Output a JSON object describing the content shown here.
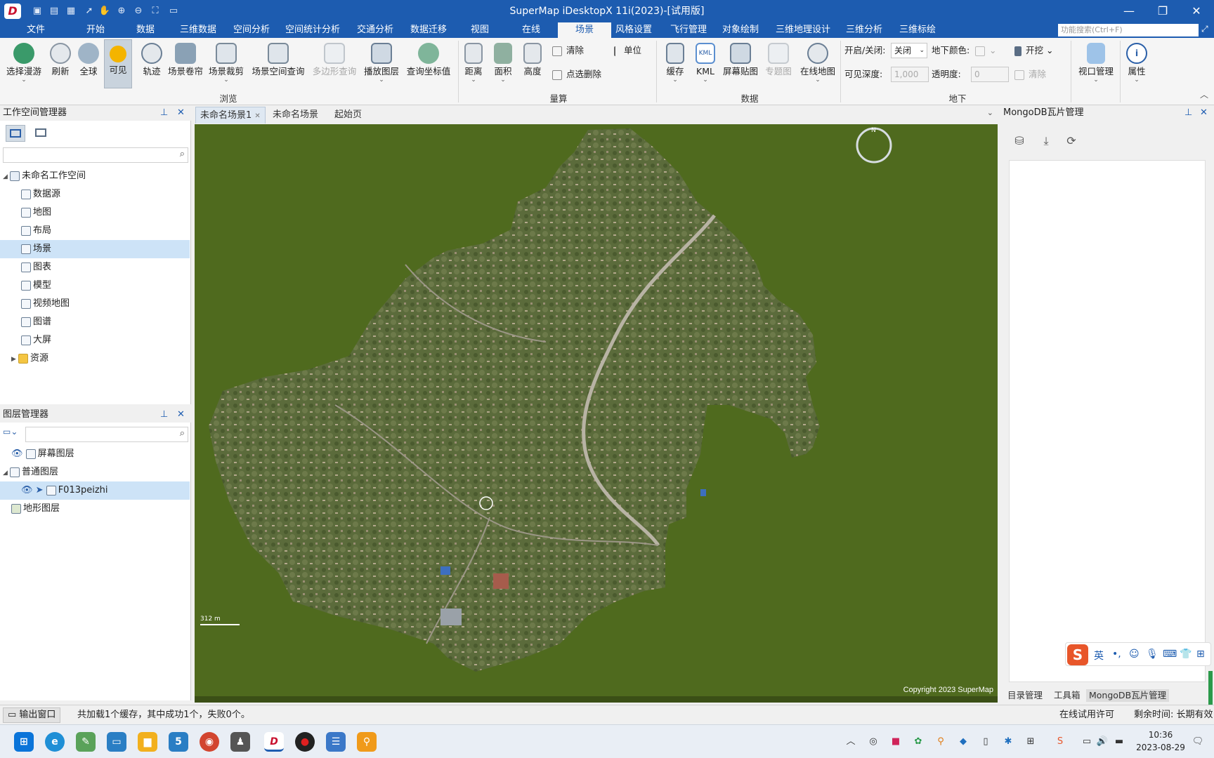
{
  "titlebar": {
    "title": "SuperMap iDesktopX 11i(2023)-[试用版]",
    "logo": "D",
    "quick_icons": [
      "save-icon",
      "save-as-icon",
      "new-icon",
      "select-icon",
      "pan-icon",
      "zoom-in-icon",
      "zoom-out-icon",
      "full-extent-icon",
      "open-folder-icon"
    ],
    "controls": [
      "minimize",
      "restore",
      "close"
    ]
  },
  "menubar": {
    "items": [
      "文件",
      "开始",
      "数据",
      "三维数据",
      "空间分析",
      "空间统计分析",
      "交通分析",
      "数据迁移",
      "视图",
      "在线",
      "场景",
      "风格设置",
      "飞行管理",
      "对象绘制",
      "三维地理设计",
      "三维分析",
      "三维标绘"
    ],
    "active": "场景",
    "search_placeholder": "功能搜索(Ctrl+F)"
  },
  "ribbon": {
    "buttons": {
      "roam": "选择漫游",
      "refresh": "刷新",
      "globe": "全球",
      "visible": "可见",
      "track": "轨迹",
      "roller": "场景卷帘",
      "clip": "场景裁剪",
      "spatial_query": "场景空间查询",
      "polygon_query": "多边形查询",
      "play_layer": "播放图层",
      "query_coord": "查询坐标值",
      "distance": "距离",
      "area": "面积",
      "height": "高度",
      "clear": "清除",
      "point_delete": "点选删除",
      "unit": "单位",
      "cache": "缓存",
      "kml": "KML",
      "screen_paste": "屏幕贴图",
      "thematic": "专题图",
      "online_map": "在线地图",
      "onoff_label": "开启/关闭:",
      "onoff_value": "关闭",
      "underground_color": "地下颜色:",
      "excavate": "开挖",
      "visible_depth": "可见深度:",
      "visible_depth_value": "1,000",
      "transparency": "透明度:",
      "transparency_value": "0",
      "clear2": "清除",
      "viewport": "视口管理",
      "property": "属性"
    },
    "groups": {
      "browse": "浏览",
      "measure": "量算",
      "data": "数据",
      "underground": "地下"
    },
    "kml_icon_text": "KML"
  },
  "workspace_panel": {
    "title": "工作空间管理器",
    "tree": [
      {
        "label": "未命名工作空间",
        "icon": "workspace-icon"
      },
      {
        "label": "数据源",
        "icon": "datasource-icon"
      },
      {
        "label": "地图",
        "icon": "map-icon"
      },
      {
        "label": "布局",
        "icon": "layout-icon"
      },
      {
        "label": "场景",
        "icon": "scene-icon"
      },
      {
        "label": "图表",
        "icon": "chart-icon"
      },
      {
        "label": "模型",
        "icon": "model-icon"
      },
      {
        "label": "视频地图",
        "icon": "video-map-icon"
      },
      {
        "label": "图谱",
        "icon": "graph-icon"
      },
      {
        "label": "大屏",
        "icon": "bigscreen-icon"
      },
      {
        "label": "资源",
        "icon": "folder-icon"
      }
    ],
    "selected": "场景"
  },
  "layer_panel": {
    "title": "图层管理器",
    "tree": [
      {
        "label": "屏幕图层",
        "icon": "screen-layer-icon"
      },
      {
        "label": "普通图层",
        "icon": "normal-layer-icon"
      },
      {
        "label": "F013peizhi",
        "icon": "image-layer-icon"
      },
      {
        "label": "地形图层",
        "icon": "terrain-layer-icon"
      }
    ],
    "selected": "F013peizhi"
  },
  "doc_tabs": {
    "tabs": [
      "未命名场景1",
      "未命名场景",
      "起始页"
    ],
    "active": "未命名场景1"
  },
  "map": {
    "copyright": "Copyright 2023 SuperMap",
    "scale_text": "312 m",
    "compass": "N",
    "background_color": "#4f6a1e",
    "imagery_color": "#5a6b3c"
  },
  "mongo_panel": {
    "title": "MongoDB瓦片管理",
    "tools": [
      "add-db-icon",
      "import-icon",
      "refresh-icon"
    ],
    "bottom_tabs": [
      "目录管理",
      "工具箱",
      "MongoDB瓦片管理"
    ],
    "active_tab": "MongoDB瓦片管理"
  },
  "statusbar": {
    "output_window": "输出窗口",
    "message": "共加载1个缓存，其中成功1个，失败0个。",
    "license": "在线试用许可",
    "remaining": "剩余时间: 长期有效"
  },
  "ime": {
    "lang": "英"
  },
  "taskbar": {
    "apps": [
      "windows-icon",
      "edge-icon",
      "notepad-icon",
      "desktop-icon",
      "explorer-icon",
      "sogou-icon",
      "chrome-icon",
      "tux-icon",
      "supermap-icon",
      "record-icon",
      "notes-icon",
      "search-icon"
    ],
    "time": "10:36",
    "date": "2023-08-29"
  }
}
